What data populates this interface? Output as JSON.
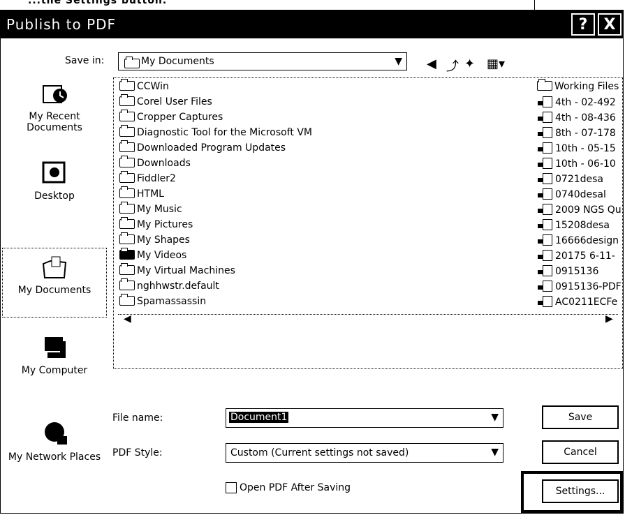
{
  "window": {
    "title": "Publish to PDF",
    "help_button": "?",
    "close_button": "X"
  },
  "top_fragment": "...the Settings button.",
  "save_in": {
    "label": "Save in:",
    "value": "My Documents"
  },
  "places": [
    {
      "label": "My Recent Documents"
    },
    {
      "label": "Desktop"
    },
    {
      "label": "My Documents"
    },
    {
      "label": "My Computer"
    },
    {
      "label": "My Network Places"
    }
  ],
  "files_left": [
    "CCWin",
    "Corel User Files",
    "Cropper Captures",
    "Diagnostic Tool for the Microsoft VM",
    "Downloaded Program Updates",
    "Downloads",
    "Fiddler2",
    "HTML",
    "My Music",
    "My Pictures",
    "My Shapes",
    "My Videos",
    "My Virtual Machines",
    "nghhwstr.default",
    "Spamassassin"
  ],
  "files_right": [
    "Working Files",
    "4th - 02-492",
    "4th - 08-436",
    "8th - 07-178",
    "10th - 05-15",
    "10th - 06-10",
    "0721desa",
    "0740desal",
    "2009 NGS Qu",
    "15208desa",
    "16666design",
    "20175 6-11-",
    "0915136",
    "0915136-PDF",
    "AC0211ECFe"
  ],
  "file_name": {
    "label": "File name:",
    "value": "Document1"
  },
  "pdf_style": {
    "label": "PDF Style:",
    "value": "Custom (Current settings not saved)"
  },
  "open_after_saving": {
    "label": "Open PDF After Saving",
    "checked": false
  },
  "buttons": {
    "save": "Save",
    "cancel": "Cancel",
    "settings": "Settings..."
  }
}
